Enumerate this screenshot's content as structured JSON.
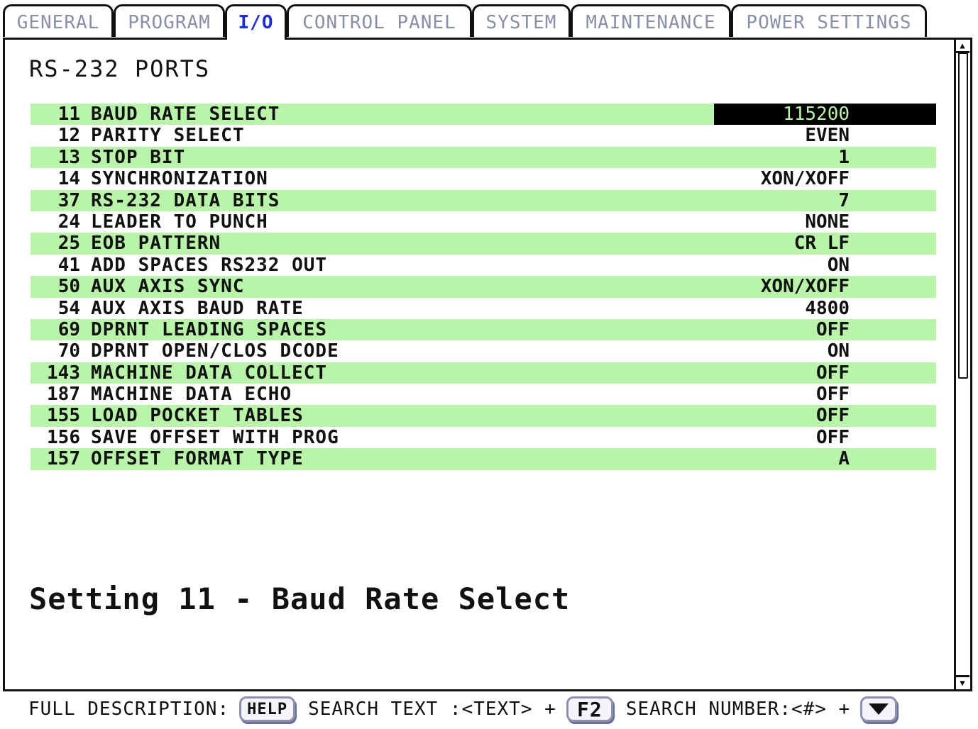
{
  "tabs": [
    {
      "label": "GENERAL",
      "active": false
    },
    {
      "label": "PROGRAM",
      "active": false
    },
    {
      "label": "I/O",
      "active": true
    },
    {
      "label": "CONTROL PANEL",
      "active": false
    },
    {
      "label": "SYSTEM",
      "active": false
    },
    {
      "label": "MAINTENANCE",
      "active": false
    },
    {
      "label": "POWER SETTINGS",
      "active": false
    }
  ],
  "section_title": "RS-232 PORTS",
  "settings": [
    {
      "number": "11",
      "name": "BAUD RATE SELECT",
      "value": "115200",
      "selected": true
    },
    {
      "number": "12",
      "name": "PARITY SELECT",
      "value": "EVEN"
    },
    {
      "number": "13",
      "name": "STOP BIT",
      "value": "1"
    },
    {
      "number": "14",
      "name": "SYNCHRONIZATION",
      "value": "XON/XOFF"
    },
    {
      "number": "37",
      "name": "RS-232 DATA BITS",
      "value": "7"
    },
    {
      "number": "24",
      "name": "LEADER TO PUNCH",
      "value": "NONE"
    },
    {
      "number": "25",
      "name": "EOB PATTERN",
      "value": "CR LF"
    },
    {
      "number": "41",
      "name": "ADD SPACES RS232 OUT",
      "value": "ON"
    },
    {
      "number": "50",
      "name": "AUX AXIS SYNC",
      "value": "XON/XOFF"
    },
    {
      "number": "54",
      "name": "AUX AXIS BAUD RATE",
      "value": "4800"
    },
    {
      "number": "69",
      "name": "DPRNT LEADING SPACES",
      "value": "OFF"
    },
    {
      "number": "70",
      "name": "DPRNT OPEN/CLOS DCODE",
      "value": "ON"
    },
    {
      "number": "143",
      "name": "MACHINE DATA COLLECT",
      "value": "OFF"
    },
    {
      "number": "187",
      "name": "MACHINE DATA ECHO",
      "value": "OFF"
    },
    {
      "number": "155",
      "name": "LOAD POCKET TABLES",
      "value": "OFF"
    },
    {
      "number": "156",
      "name": "SAVE OFFSET WITH PROG",
      "value": "OFF"
    },
    {
      "number": "157",
      "name": "OFFSET FORMAT TYPE",
      "value": "A"
    }
  ],
  "description": "Setting 11 - Baud Rate Select",
  "footer": {
    "full_description_label": "FULL DESCRIPTION:",
    "help_key": "HELP",
    "search_text_label": "SEARCH TEXT :<TEXT> +",
    "f2_key": "F2",
    "search_number_label": "SEARCH NUMBER:<#> +",
    "down_key_icon": "down-arrow"
  },
  "scrollbar": {
    "up_icon": "scroll-up-arrow",
    "down_icon": "scroll-down-arrow"
  },
  "colors": {
    "row_band": "#b8f5a8",
    "active_tab_text": "#1a2cf0",
    "inactive_tab_text": "#8a8fa8",
    "selected_value_bg": "#000000",
    "selected_value_text": "#b8f5a8"
  }
}
